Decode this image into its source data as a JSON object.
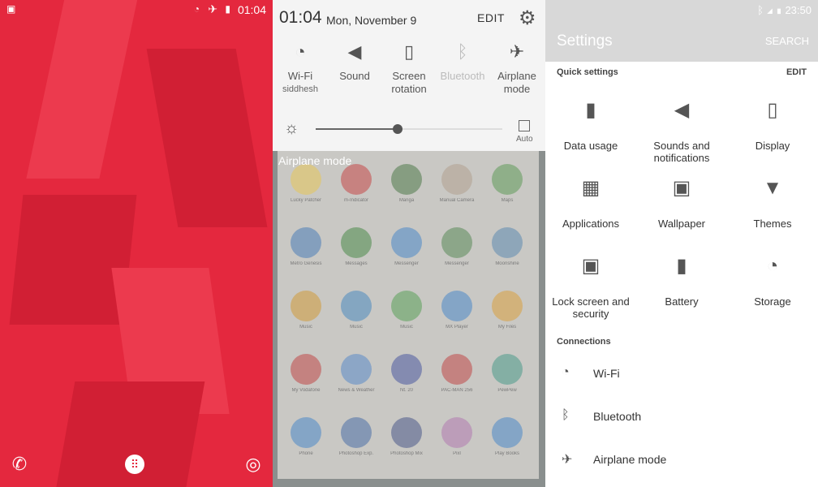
{
  "home": {
    "status_time": "01:04",
    "dock": [
      {
        "icon": "phone-icon",
        "glyph": "✆"
      },
      {
        "icon": "apps-icon",
        "glyph": "⠿"
      },
      {
        "icon": "chrome-icon",
        "glyph": "◎"
      }
    ]
  },
  "shade": {
    "clock": "01:04",
    "date": "Mon, November 9",
    "edit_label": "EDIT",
    "toggles": [
      {
        "label": "Wi-Fi",
        "sub": "siddhesh",
        "icon": "wifi-icon",
        "glyph": "◔",
        "on": true
      },
      {
        "label": "Sound",
        "sub": "",
        "icon": "speaker-icon",
        "glyph": "◀",
        "on": true
      },
      {
        "label": "Screen rotation",
        "sub": "",
        "icon": "screen-rotation-icon",
        "glyph": "▯",
        "on": true
      },
      {
        "label": "Bluetooth",
        "sub": "",
        "icon": "bluetooth-icon",
        "glyph": "ᛒ",
        "on": false
      },
      {
        "label": "Airplane mode",
        "sub": "",
        "icon": "airplane-icon",
        "glyph": "✈",
        "on": true
      }
    ],
    "brightness_level": 0.44,
    "auto_label": "Auto",
    "airplane_banner": "Airplane mode",
    "apps": [
      {
        "name": "Lucky Patcher",
        "color": "#e6c65a"
      },
      {
        "name": "m-Indicator",
        "color": "#c44848"
      },
      {
        "name": "Manga",
        "color": "#4e7a4a"
      },
      {
        "name": "Manual Camera",
        "color": "#b0a090"
      },
      {
        "name": "Maps",
        "color": "#5f9a5a"
      },
      {
        "name": "Metro Genesis",
        "color": "#4a7db8"
      },
      {
        "name": "Messages",
        "color": "#4a8a4a"
      },
      {
        "name": "Messenger",
        "color": "#4a88c8"
      },
      {
        "name": "Messenger",
        "color": "#5a8a5a"
      },
      {
        "name": "Moonshine",
        "color": "#5c8ab0"
      },
      {
        "name": "Music",
        "color": "#d09a3a"
      },
      {
        "name": "Music",
        "color": "#4a8ac0"
      },
      {
        "name": "Music",
        "color": "#5aa05a"
      },
      {
        "name": "MX Player",
        "color": "#4a88c8"
      },
      {
        "name": "My Files",
        "color": "#d8a040"
      },
      {
        "name": "My Vodafone",
        "color": "#c04848"
      },
      {
        "name": "News & Weather",
        "color": "#5a8ac8"
      },
      {
        "name": "Nt. 20",
        "color": "#4a5aa0"
      },
      {
        "name": "PAC-MAN 256",
        "color": "#c04848"
      },
      {
        "name": "PewPew",
        "color": "#4a9a8a"
      },
      {
        "name": "Phone",
        "color": "#4a88c8"
      },
      {
        "name": "Photoshop Exp.",
        "color": "#4a70a8"
      },
      {
        "name": "Photoshop Mix",
        "color": "#4a5a8a"
      },
      {
        "name": "Pixl",
        "color": "#b07ab0"
      },
      {
        "name": "Play Books",
        "color": "#4a88c8"
      }
    ]
  },
  "settings": {
    "status_time": "23:50",
    "title": "Settings",
    "search_label": "SEARCH",
    "quick_section": "Quick settings",
    "edit_label": "EDIT",
    "tiles": [
      {
        "label": "Data usage",
        "icon": "data-usage-icon",
        "glyph": "▮"
      },
      {
        "label": "Sounds and notifications",
        "icon": "volume-icon",
        "glyph": "◀"
      },
      {
        "label": "Display",
        "icon": "display-icon",
        "glyph": "▯"
      },
      {
        "label": "Applications",
        "icon": "applications-icon",
        "glyph": "▦"
      },
      {
        "label": "Wallpaper",
        "icon": "wallpaper-icon",
        "glyph": "▣"
      },
      {
        "label": "Themes",
        "icon": "themes-icon",
        "glyph": "▼"
      },
      {
        "label": "Lock screen and security",
        "icon": "lock-icon",
        "glyph": "🔒"
      },
      {
        "label": "Battery",
        "icon": "battery-icon",
        "glyph": "▮"
      },
      {
        "label": "Storage",
        "icon": "storage-icon",
        "glyph": "◔"
      }
    ],
    "connections_section": "Connections",
    "connections": [
      {
        "label": "Wi-Fi",
        "icon": "wifi-icon",
        "glyph": "◔"
      },
      {
        "label": "Bluetooth",
        "icon": "bluetooth-icon",
        "glyph": "ᛒ"
      },
      {
        "label": "Airplane mode",
        "icon": "airplane-icon",
        "glyph": "✈"
      }
    ]
  }
}
